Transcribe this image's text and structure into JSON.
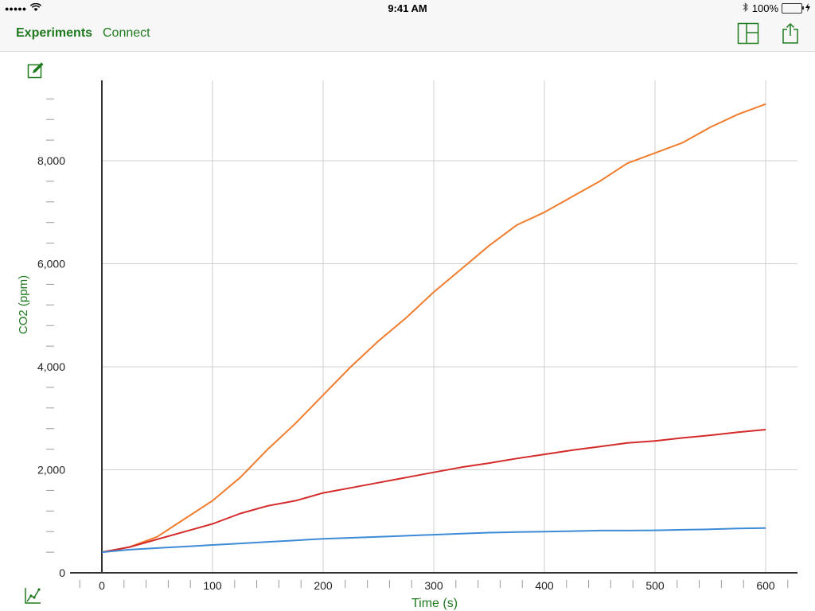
{
  "status_bar": {
    "carrier_dots": "●●●●●",
    "time": "9:41 AM",
    "battery_percent": "100%",
    "battery_level": 1.0
  },
  "nav": {
    "experiments_label": "Experiments",
    "connect_label": "Connect",
    "icons": [
      "layout-icon",
      "share-icon"
    ]
  },
  "tools": {
    "edit_icon": "edit-icon",
    "graph_icon": "graph-settings-icon"
  },
  "colors": {
    "accent": "#1f7a1f",
    "series_orange": "#f07c2e",
    "series_red": "#d42a2a",
    "series_blue": "#3d8bd6"
  },
  "chart_data": {
    "type": "line",
    "xlabel": "Time (s)",
    "ylabel": "CO2 (ppm)",
    "xlim": [
      -20,
      620
    ],
    "ylim": [
      0,
      9200
    ],
    "x_ticks": [
      0,
      100,
      200,
      300,
      400,
      500,
      600
    ],
    "x_tick_labels": [
      "0",
      "100",
      "200",
      "300",
      "400",
      "500",
      "600"
    ],
    "y_ticks": [
      0,
      2000,
      4000,
      6000,
      8000
    ],
    "y_tick_labels": [
      "0",
      "2,000",
      "4,000",
      "6,000",
      "8,000"
    ],
    "grid": true,
    "series": [
      {
        "color": "#f07c2e",
        "x": [
          0,
          25,
          50,
          75,
          100,
          125,
          150,
          175,
          200,
          225,
          250,
          275,
          300,
          325,
          350,
          375,
          400,
          425,
          450,
          475,
          500,
          525,
          550,
          575,
          600
        ],
        "y": [
          400,
          500,
          700,
          1050,
          1400,
          1850,
          2400,
          2900,
          3450,
          4000,
          4500,
          4950,
          5450,
          5900,
          6350,
          6750,
          7000,
          7300,
          7600,
          7950,
          8150,
          8350,
          8650,
          8900,
          9100
        ]
      },
      {
        "color": "#d42a2a",
        "x": [
          0,
          25,
          50,
          75,
          100,
          125,
          150,
          175,
          200,
          225,
          250,
          275,
          300,
          325,
          350,
          375,
          400,
          425,
          450,
          475,
          500,
          525,
          550,
          575,
          600
        ],
        "y": [
          400,
          500,
          650,
          800,
          950,
          1150,
          1300,
          1400,
          1550,
          1650,
          1750,
          1850,
          1950,
          2050,
          2130,
          2220,
          2300,
          2380,
          2450,
          2520,
          2560,
          2620,
          2670,
          2730,
          2780
        ]
      },
      {
        "color": "#3d8bd6",
        "x": [
          0,
          25,
          50,
          75,
          100,
          125,
          150,
          175,
          200,
          225,
          250,
          275,
          300,
          325,
          350,
          375,
          400,
          425,
          450,
          475,
          500,
          525,
          550,
          575,
          600
        ],
        "y": [
          400,
          450,
          480,
          510,
          540,
          570,
          600,
          630,
          660,
          680,
          700,
          720,
          740,
          760,
          780,
          790,
          800,
          810,
          820,
          820,
          825,
          835,
          845,
          860,
          870
        ]
      }
    ]
  }
}
